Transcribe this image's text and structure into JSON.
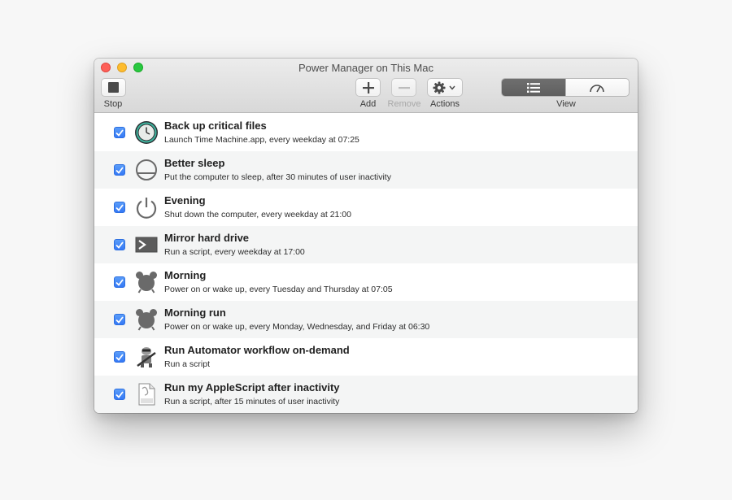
{
  "window": {
    "title": "Power Manager on This Mac"
  },
  "toolbar": {
    "stop_label": "Stop",
    "add_label": "Add",
    "remove_label": "Remove",
    "actions_label": "Actions",
    "view_label": "View"
  },
  "icons": {
    "stop": "stop-square-icon",
    "add": "plus-icon",
    "remove": "minus-icon",
    "actions": "gear-icon",
    "view_list": "list-icon",
    "view_gauge": "gauge-icon"
  },
  "colors": {
    "checkbox": "#3478f6",
    "close": "#fe5f57",
    "minimize": "#febc2e",
    "maximize": "#28c840"
  },
  "events": [
    {
      "title": "Back up critical files",
      "subtitle": "Launch Time Machine.app, every weekday at 07:25",
      "icon": "time-machine-icon",
      "checked": true
    },
    {
      "title": "Better sleep",
      "subtitle": "Put the computer to sleep, after 30 minutes of user inactivity",
      "icon": "sleep-icon",
      "checked": true
    },
    {
      "title": "Evening",
      "subtitle": "Shut down the computer, every weekday at 21:00",
      "icon": "power-icon",
      "checked": true
    },
    {
      "title": "Mirror hard drive",
      "subtitle": "Run a script, every weekday at 17:00",
      "icon": "terminal-icon",
      "checked": true
    },
    {
      "title": "Morning",
      "subtitle": "Power on or wake up, every Tuesday and Thursday at 07:05",
      "icon": "alarm-clock-icon",
      "checked": true
    },
    {
      "title": "Morning run",
      "subtitle": "Power on or wake up, every Monday, Wednesday, and Friday at 06:30",
      "icon": "alarm-clock-icon",
      "checked": true
    },
    {
      "title": "Run Automator workflow on-demand",
      "subtitle": "Run a script",
      "icon": "automator-icon",
      "checked": true
    },
    {
      "title": "Run my AppleScript after inactivity",
      "subtitle": "Run a script, after 15 minutes of user inactivity",
      "icon": "text-document-icon",
      "checked": true
    }
  ]
}
